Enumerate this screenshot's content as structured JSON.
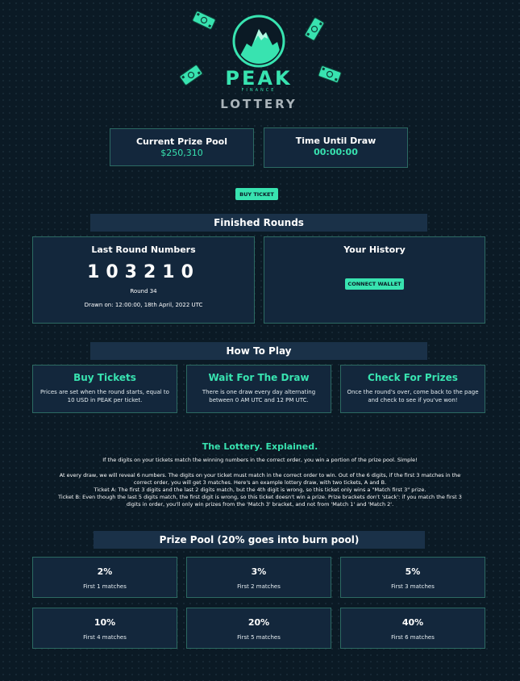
{
  "brand": {
    "name": "PEAK",
    "sub": "FINANCE",
    "product": "LOTTERY"
  },
  "prize_pool": {
    "label": "Current Prize Pool",
    "value": "$250,310"
  },
  "time_until_draw": {
    "label": "Time Until Draw",
    "value": "00:00:00"
  },
  "buy_ticket_label": "BUY TICKET",
  "finished_rounds": {
    "title": "Finished Rounds",
    "last_round": {
      "title": "Last Round Numbers",
      "numbers": "103210",
      "round": "Round 34",
      "drawn_on": "Drawn on: 12:00:00, 18th April, 2022 UTC"
    },
    "history": {
      "title": "Your History",
      "connect_label": "CONNECT WALLET"
    }
  },
  "how_to_play": {
    "title": "How To Play",
    "cards": [
      {
        "title": "Buy Tickets",
        "line1": "Prices are set when the round starts, equal to",
        "line2": "10 USD in PEAK per ticket."
      },
      {
        "title": "Wait For The Draw",
        "line1": "There is one draw every day alternating",
        "line2": "between 0 AM UTC and 12 PM UTC."
      },
      {
        "title": "Check For Prizes",
        "line1": "Once the round's over, come back to the page",
        "line2": "and check to see if you've won!"
      }
    ]
  },
  "explained": {
    "title": "The Lottery. Explained.",
    "intro": "If the digits on your tickets match the winning numbers in the correct order, you win a portion of the prize pool. Simple!",
    "p1a": "At every draw, we will reveal 6 numbers. The digits on your ticket must match in the correct order to win. Out of the 6 digits, if the first 3 matches in the",
    "p1b": "correct order, you will get 3 matches. Here's an example lottery draw, with two tickets, A and B.",
    "ticket_a": "Ticket A: The first 3 digits and the last 2 digits match, but the 4th digit is wrong, so this ticket only wins a \"Match first 3\" prize.",
    "ticket_b1": "Ticket B: Even though the last 5 digits match, the first digit is wrong, so this ticket doesn't win a prize. Prize brackets don't 'stack': if you match the first 3",
    "ticket_b2": "digits in order, you'll only win prizes from the 'Match 3' bracket, and not from 'Match 1' and 'Match 2'."
  },
  "prize_distribution": {
    "title": "Prize Pool (20% goes into burn pool)",
    "brackets": [
      {
        "pct": "2%",
        "label": "First 1 matches"
      },
      {
        "pct": "3%",
        "label": "First 2 matches"
      },
      {
        "pct": "5%",
        "label": "First 3 matches"
      },
      {
        "pct": "10%",
        "label": "First 4 matches"
      },
      {
        "pct": "20%",
        "label": "First 5 matches"
      },
      {
        "pct": "40%",
        "label": "First 6 matches"
      }
    ]
  },
  "colors": {
    "accent": "#38e3b0",
    "background": "#0b1a25",
    "panel": "#13273c",
    "border": "#2c6a63"
  },
  "icons": [
    "money-bill-icon",
    "mountain-icon"
  ]
}
